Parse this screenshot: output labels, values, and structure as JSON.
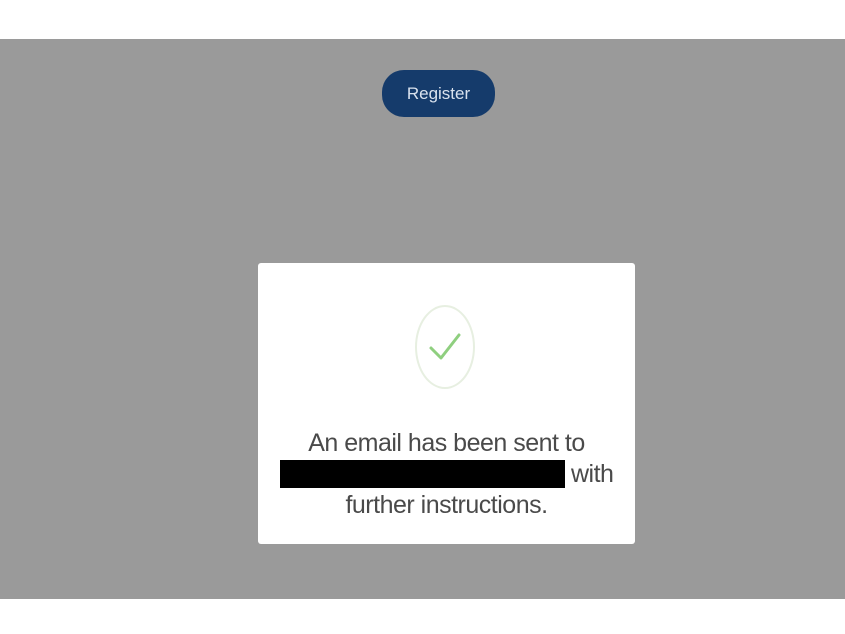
{
  "header": {
    "register_label": "Register"
  },
  "modal": {
    "icon": "checkmark-icon",
    "message_line1": "An email has been sent to",
    "message_line2_suffix": "with",
    "message_line3": "further instructions."
  },
  "colors": {
    "overlay": "#9a9a9a",
    "register_button": "#153b6b",
    "check": "#8fcf7f"
  }
}
